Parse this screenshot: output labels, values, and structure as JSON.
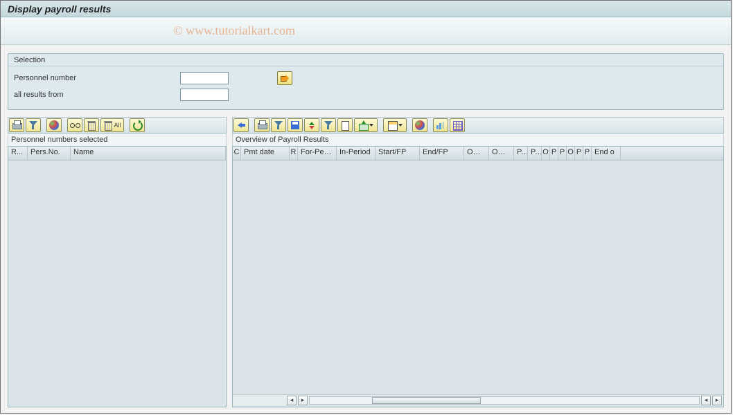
{
  "header": {
    "title": "Display payroll results"
  },
  "watermark": "© www.tutorialkart.com",
  "selection": {
    "title": "Selection",
    "fields": {
      "personnel_number_label": "Personnel number",
      "personnel_number_value": "",
      "all_results_from_label": "all results from",
      "all_results_from_value": ""
    }
  },
  "left_panel": {
    "subtitle": "Personnel numbers selected",
    "toolbar": {
      "print": "print-icon",
      "filter": "filter-icon",
      "globe": "globe-icon",
      "glasses": "glasses-icon",
      "trash": "trash-icon",
      "trash_all": "trash-all-icon",
      "trash_all_text": "All",
      "refresh": "refresh-icon"
    },
    "columns": [
      "R...",
      "Pers.No.",
      "Name"
    ]
  },
  "right_panel": {
    "subtitle": "Overview of Payroll Results",
    "toolbar": {
      "back": "back-icon",
      "print": "print-icon",
      "filter": "filter-icon",
      "save": "save-icon",
      "sort": "sort-icon",
      "filter2": "filter-icon",
      "doc": "doc-icon",
      "export": "export-icon",
      "layout": "layout-icon",
      "globe": "globe-icon",
      "graph": "graph-icon",
      "grid": "grid-icon"
    },
    "columns": [
      "C",
      "Pmt date",
      "R",
      "For-Peri...",
      "In-Period",
      "Start/FP",
      "End/FP",
      "OC ...",
      "OC ...",
      "P...",
      "P...",
      "O",
      "P",
      "P",
      "O",
      "P",
      "P",
      "End o"
    ]
  }
}
